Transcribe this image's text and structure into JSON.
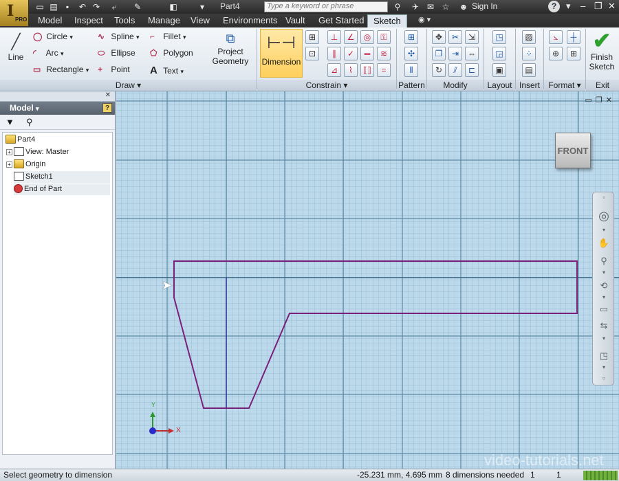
{
  "titlebar": {
    "logo_letter": "I",
    "logo_badge": "PRO",
    "doc_title": "Part4",
    "search_placeholder": "Type a keyword or phrase",
    "sign_in": "Sign In",
    "help": "?"
  },
  "tabs": [
    {
      "label": "Model"
    },
    {
      "label": "Inspect"
    },
    {
      "label": "Tools"
    },
    {
      "label": "Manage"
    },
    {
      "label": "View"
    },
    {
      "label": "Environments"
    },
    {
      "label": "Vault"
    },
    {
      "label": "Get Started"
    },
    {
      "label": "Sketch",
      "active": true
    }
  ],
  "ribbon": {
    "draw": {
      "line": "Line",
      "circle": "Circle",
      "arc": "Arc",
      "rectangle": "Rectangle",
      "spline": "Spline",
      "ellipse": "Ellipse",
      "point": "Point",
      "fillet": "Fillet",
      "polygon": "Polygon",
      "text": "Text",
      "panel": "Draw"
    },
    "project_geometry": [
      "Project",
      "Geometry"
    ],
    "dimension": "Dimension",
    "panels": {
      "constrain": "Constrain",
      "pattern": "Pattern",
      "modify": "Modify",
      "layout": "Layout",
      "insert": "Insert",
      "format": "Format",
      "exit": "Exit"
    },
    "finish_sketch": [
      "Finish",
      "Sketch"
    ]
  },
  "browser": {
    "header": "Model",
    "tree": [
      {
        "label": "Part4",
        "level": 0,
        "icon": "part-icon"
      },
      {
        "label": "View: Master",
        "level": 1,
        "icon": "view-icon",
        "expander": "+"
      },
      {
        "label": "Origin",
        "level": 1,
        "icon": "folder-icon",
        "expander": "+"
      },
      {
        "label": "Sketch1",
        "level": 1,
        "icon": "sketch-icon"
      },
      {
        "label": "End of Part",
        "level": 1,
        "icon": "end-of-part-icon"
      }
    ]
  },
  "canvas": {
    "viewcube_face": "FRONT",
    "axis_x": "X",
    "axis_y": "Y",
    "watermark": "video-tutorials.net"
  },
  "status": {
    "prompt": "Select geometry to dimension",
    "coords": "-25.231 mm, 4.695 mm",
    "dims_needed": "8 dimensions needed",
    "n1": "1",
    "n2": "1"
  },
  "colors": {
    "canvas_bg": "#bcd9ec",
    "grid_minor": "#8fb6cc",
    "grid_major": "#5e8aa3",
    "sketch": "#7a1f7a",
    "active_tab": "#dfe6ee",
    "dimension_highlight": "#ffd36b"
  }
}
